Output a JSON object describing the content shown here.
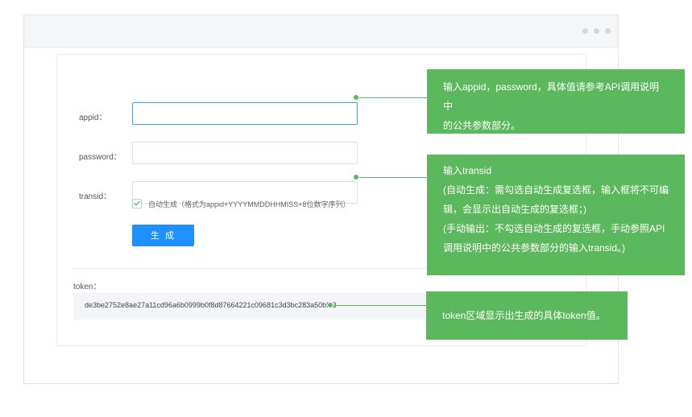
{
  "window": {
    "dots": [
      "",
      "",
      ""
    ]
  },
  "form": {
    "appid": {
      "label": "appid：",
      "value": "",
      "placeholder": ""
    },
    "password": {
      "label": "password：",
      "value": "",
      "placeholder": ""
    },
    "transid": {
      "label": "transid：",
      "value": "",
      "placeholder": ""
    },
    "auto_generate": {
      "checked": true,
      "label": "自动生成（格式为appid+YYYYMMDDHHMISS+8位数字序列）"
    },
    "generate_button": "生 成"
  },
  "token": {
    "label": "token：",
    "value": "de3be2752e8ae27a11cd96a6b0999b0f8d87664221c09681c3d3bc283a50bf73"
  },
  "callouts": {
    "appid": [
      "输入appid，password，具体值请参考API调用说明中",
      "的公共参数部分。"
    ],
    "transid": [
      "输入transid",
      "(自动生成：需勾选自动生成复选框，输入框将不可编",
      "辑，会显示出自动生成的复选框；)",
      "(手动输出：不勾选自动生成的复选框，手动参照API",
      "调用说明中的公共参数部分的输入transid。)"
    ],
    "token": [
      "token区域显示出生成的具体token值。"
    ]
  },
  "colors": {
    "callout": "#5cb85c",
    "button": "#1e90ff",
    "focus_border": "#409eff"
  }
}
